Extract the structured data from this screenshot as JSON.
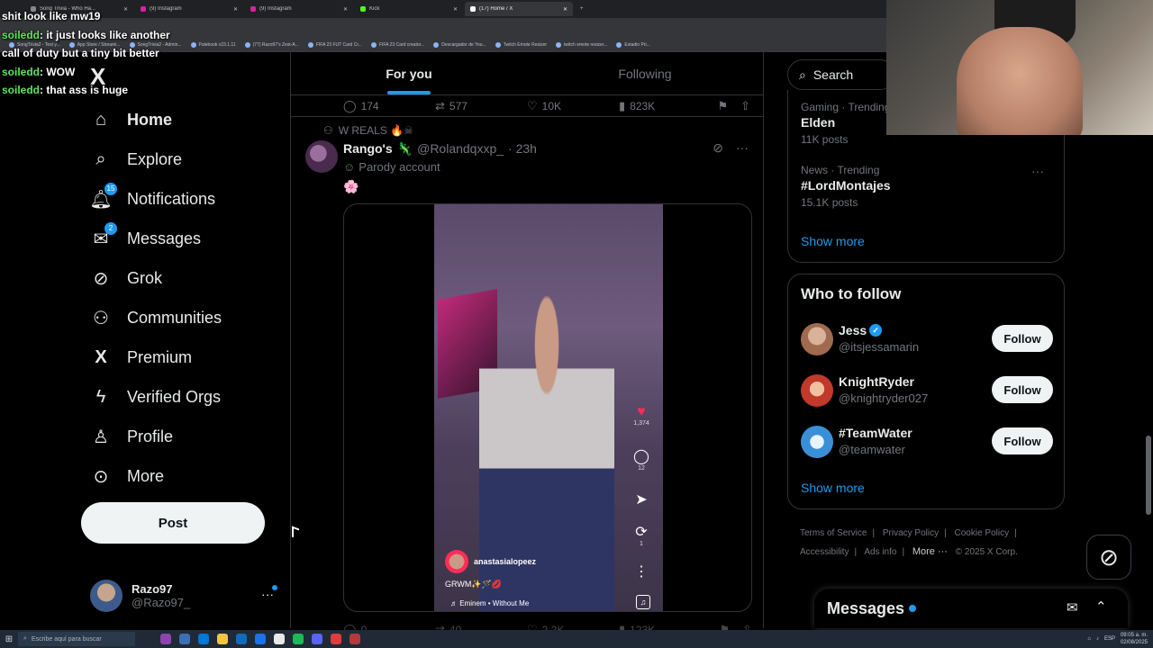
{
  "browser": {
    "tabs": [
      {
        "label": "Song Trivia - Who Ha...",
        "active": false
      },
      {
        "label": "(9) Instagram",
        "active": false
      },
      {
        "label": "(9) Instagram",
        "active": false
      },
      {
        "label": "Kick",
        "active": false
      },
      {
        "label": "(17) Home / X",
        "active": true
      }
    ],
    "bookmarks": [
      "SongTrivia2 - Test y...",
      "App Store / Streami...",
      "SongTrivia2 - Admin...",
      "Palebook v23.1.11",
      "(77) Razo97's Zest-A...",
      "FIFA 23 FUT Card Cr...",
      "FIFA 23 Card creator...",
      "Descargador de You...",
      "Twitch Emote Resizer",
      "twitch emote resizer...",
      "Estadio Pri..."
    ]
  },
  "chat": [
    {
      "user": "",
      "message": "shit look like mw19"
    },
    {
      "user": "soiledd",
      "message": ": it just looks like another"
    },
    {
      "user": "",
      "message": "call of duty but a tiny bit better"
    },
    {
      "user": "soiledd",
      "message": ": WOW"
    },
    {
      "user": "soiledd",
      "message": ": that ass is huge"
    }
  ],
  "nav": {
    "logo": "X",
    "items": [
      {
        "label": "Home",
        "icon": "home-icon",
        "glyph": "⌂",
        "badge": ""
      },
      {
        "label": "Explore",
        "icon": "search-icon",
        "glyph": "⌕",
        "badge": ""
      },
      {
        "label": "Notifications",
        "icon": "bell-icon",
        "glyph": "♫",
        "badge": "15"
      },
      {
        "label": "Messages",
        "icon": "envelope-icon",
        "glyph": "✉",
        "badge": "2"
      },
      {
        "label": "Grok",
        "icon": "grok-icon",
        "glyph": "⊘",
        "badge": ""
      },
      {
        "label": "Communities",
        "icon": "people-icon",
        "glyph": "⚇",
        "badge": ""
      },
      {
        "label": "Premium",
        "icon": "x-icon",
        "glyph": "X",
        "badge": ""
      },
      {
        "label": "Verified Orgs",
        "icon": "lightning-icon",
        "glyph": "ϟ",
        "badge": ""
      },
      {
        "label": "Profile",
        "icon": "person-icon",
        "glyph": "♙",
        "badge": ""
      },
      {
        "label": "More",
        "icon": "more-circle-icon",
        "glyph": "⋯",
        "badge": ""
      }
    ],
    "post_label": "Post",
    "account": {
      "name": "Razo97",
      "handle": "@Razo97_",
      "more": "···"
    }
  },
  "timeline": {
    "tabs": [
      "For you",
      "Following"
    ],
    "prev_actions": {
      "replies": "174",
      "reposts": "577",
      "likes": "10K",
      "views": "823K"
    },
    "tweet": {
      "social_context": "W REALS 🔥☠",
      "name": "Rango's",
      "emoji": "🦎",
      "handle": "@Rolandqxxp_",
      "time": "· 23h",
      "parody": "Parody account",
      "text": "🌸"
    },
    "video": {
      "likes": "1,374",
      "comments": "12",
      "shares": "1",
      "user": "anastasialopeez",
      "caption": "GRWM✨🪄💋",
      "song": "♬ Eminem • Without Me"
    },
    "next_actions": {
      "replies": "0",
      "reposts": "40",
      "likes": "2.2K",
      "views": "123K"
    }
  },
  "sidebar": {
    "search_placeholder": "Search",
    "trends": [
      {
        "context": "Gaming · Trending",
        "name": "Elden",
        "count": "11K posts"
      },
      {
        "context": "News · Trending",
        "name": "#LordMontajes",
        "count": "15.1K posts"
      }
    ],
    "trends_show_more": "Show more",
    "who_to_follow_title": "Who to follow",
    "follow_users": [
      {
        "name": "Jess",
        "handle": "@itsjessamarin",
        "verified": true,
        "button": "Follow",
        "avatar_color": "#a06a4f"
      },
      {
        "name": "KnightRyder",
        "handle": "@knightryder027",
        "verified": false,
        "button": "Follow",
        "avatar_color": "#c0392b"
      },
      {
        "name": "#TeamWater",
        "handle": "@teamwater",
        "verified": false,
        "button": "Follow",
        "avatar_color": "#3b8fd6"
      }
    ],
    "wtf_show_more": "Show more",
    "footer": [
      "Terms of Service",
      "Privacy Policy",
      "Cookie Policy",
      "Accessibility",
      "Ads info",
      "More ···",
      "© 2025 X Corp."
    ],
    "messages_title": "Messages"
  },
  "taskbar": {
    "search_placeholder": "Escribe aquí para buscar",
    "lang": "ESP",
    "time": "09:05 a. m.",
    "date": "02/08/2025"
  },
  "colors": {
    "accent": "#1d9bf0",
    "background": "#000000",
    "border": "#2f3336",
    "muted": "#71767b"
  }
}
